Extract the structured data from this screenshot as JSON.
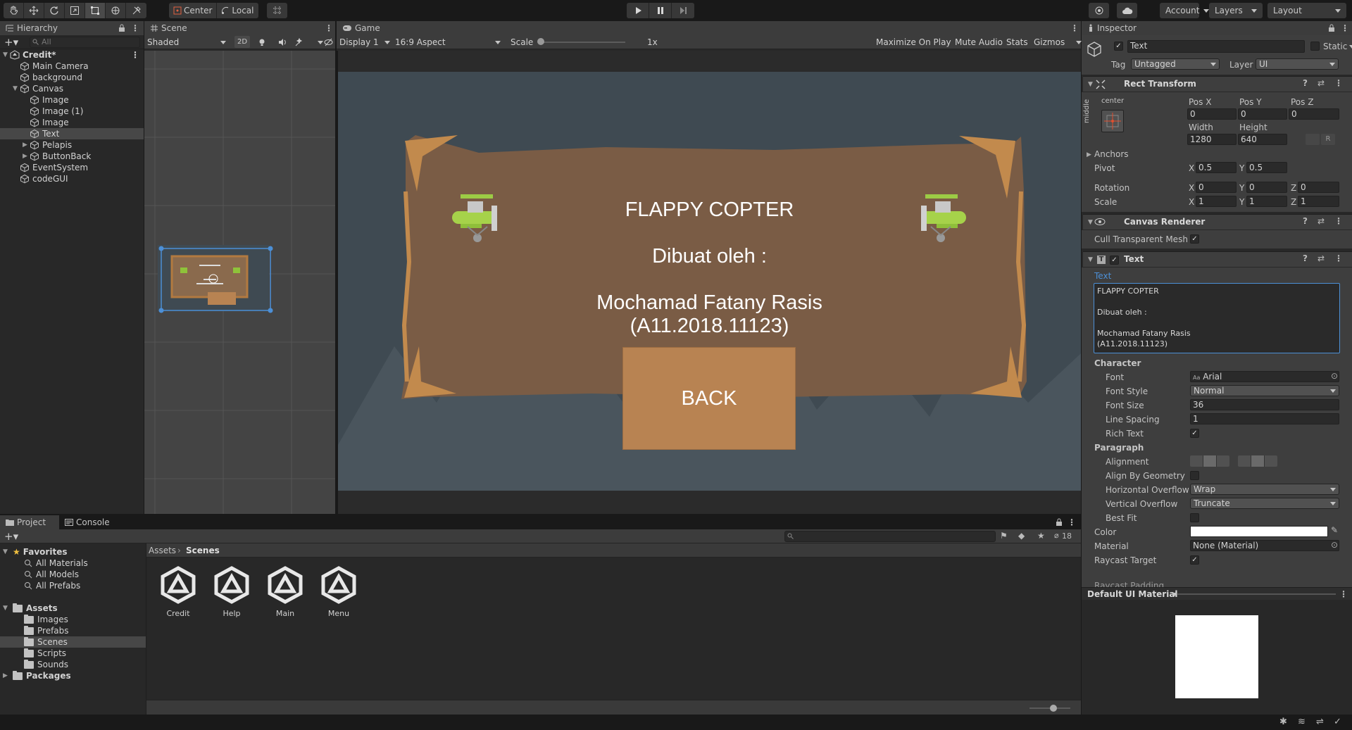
{
  "toolbar": {
    "pivot_mode": "Center",
    "pivot_space": "Local",
    "account": "Account",
    "layers": "Layers",
    "layout": "Layout"
  },
  "hierarchy": {
    "tab": "Hierarchy",
    "search_placeholder": "All",
    "items": [
      {
        "label": "Credit*",
        "depth": 0,
        "expanded": true,
        "scene": true
      },
      {
        "label": "Main Camera",
        "depth": 1
      },
      {
        "label": "background",
        "depth": 1
      },
      {
        "label": "Canvas",
        "depth": 1,
        "expanded": true
      },
      {
        "label": "Image",
        "depth": 2
      },
      {
        "label": "Image (1)",
        "depth": 2
      },
      {
        "label": "Image",
        "depth": 2
      },
      {
        "label": "Text",
        "depth": 2,
        "selected": true
      },
      {
        "label": "Pelapis",
        "depth": 2,
        "collapsed": true
      },
      {
        "label": "ButtonBack",
        "depth": 2,
        "collapsed": true
      },
      {
        "label": "EventSystem",
        "depth": 1
      },
      {
        "label": "codeGUI",
        "depth": 1
      }
    ]
  },
  "scene": {
    "tab": "Scene",
    "shading": "Shaded",
    "mode_2d": "2D"
  },
  "game": {
    "tab": "Game",
    "display": "Display 1",
    "aspect": "16:9 Aspect",
    "scale_label": "Scale",
    "scale_value": "1x",
    "maximize": "Maximize On Play",
    "mute": "Mute Audio",
    "stats": "Stats",
    "gizmos": "Gizmos",
    "title": "FLAPPY COPTER",
    "made_by": "Dibuat oleh :",
    "author": "Mochamad Fatany Rasis",
    "nim": "(A11.2018.11123)",
    "back": "BACK"
  },
  "inspector": {
    "tab": "Inspector",
    "object_name": "Text",
    "static_label": "Static",
    "tag_label": "Tag",
    "tag_value": "Untagged",
    "layer_label": "Layer",
    "layer_value": "UI",
    "rect_transform": {
      "title": "Rect Transform",
      "anchor_h": "center",
      "anchor_v": "middle",
      "pos_x_label": "Pos X",
      "pos_x": "0",
      "pos_y_label": "Pos Y",
      "pos_y": "0",
      "pos_z_label": "Pos Z",
      "pos_z": "0",
      "width_label": "Width",
      "width": "1280",
      "height_label": "Height",
      "height": "640",
      "r_button": "R",
      "anchors": "Anchors",
      "pivot_label": "Pivot",
      "pivot_x": "0.5",
      "pivot_y": "0.5",
      "rotation_label": "Rotation",
      "rot_x": "0",
      "rot_y": "0",
      "rot_z": "0",
      "scale_label": "Scale",
      "scale_x": "1",
      "scale_y": "1",
      "scale_z": "1",
      "x": "X",
      "y": "Y",
      "z": "Z"
    },
    "canvas_renderer": {
      "title": "Canvas Renderer",
      "cull_label": "Cull Transparent Mesh"
    },
    "text_component": {
      "title": "Text",
      "text_label": "Text",
      "text_lines": [
        "FLAPPY COPTER",
        "",
        "Dibuat oleh :",
        "",
        "Mochamad Fatany Rasis",
        "(A11.2018.11123)"
      ],
      "character": "Character",
      "font_label": "Font",
      "font_value": "Arial",
      "font_style_label": "Font Style",
      "font_style_value": "Normal",
      "font_size_label": "Font Size",
      "font_size_value": "36",
      "line_spacing_label": "Line Spacing",
      "line_spacing_value": "1",
      "rich_text_label": "Rich Text",
      "paragraph": "Paragraph",
      "alignment_label": "Alignment",
      "align_geometry_label": "Align By Geometry",
      "h_overflow_label": "Horizontal Overflow",
      "h_overflow_value": "Wrap",
      "v_overflow_label": "Vertical Overflow",
      "v_overflow_value": "Truncate",
      "best_fit_label": "Best Fit",
      "color_label": "Color",
      "color_value": "#ffffff",
      "material_label": "Material",
      "material_value": "None (Material)",
      "raycast_label": "Raycast Target",
      "raycast_padding_label": "Raycast Padding"
    },
    "material_preview": "Default UI Material"
  },
  "project": {
    "tab_project": "Project",
    "tab_console": "Console",
    "favorites": "Favorites",
    "fav_items": [
      "All Materials",
      "All Models",
      "All Prefabs"
    ],
    "assets": "Assets",
    "asset_folders": [
      "Images",
      "Prefabs",
      "Scenes",
      "Scripts",
      "Sounds"
    ],
    "packages": "Packages",
    "breadcrumb_root": "Assets",
    "breadcrumb_current": "Scenes",
    "hidden_count": "18",
    "scene_files": [
      "Credit",
      "Help",
      "Main",
      "Menu"
    ]
  },
  "colors": {
    "panel_bg": "#282828",
    "game_bg": "#3f4a52",
    "board": "#7a5c45",
    "back_button": "#b88352",
    "selection": "#474747",
    "link_blue": "#4c8fd6"
  }
}
